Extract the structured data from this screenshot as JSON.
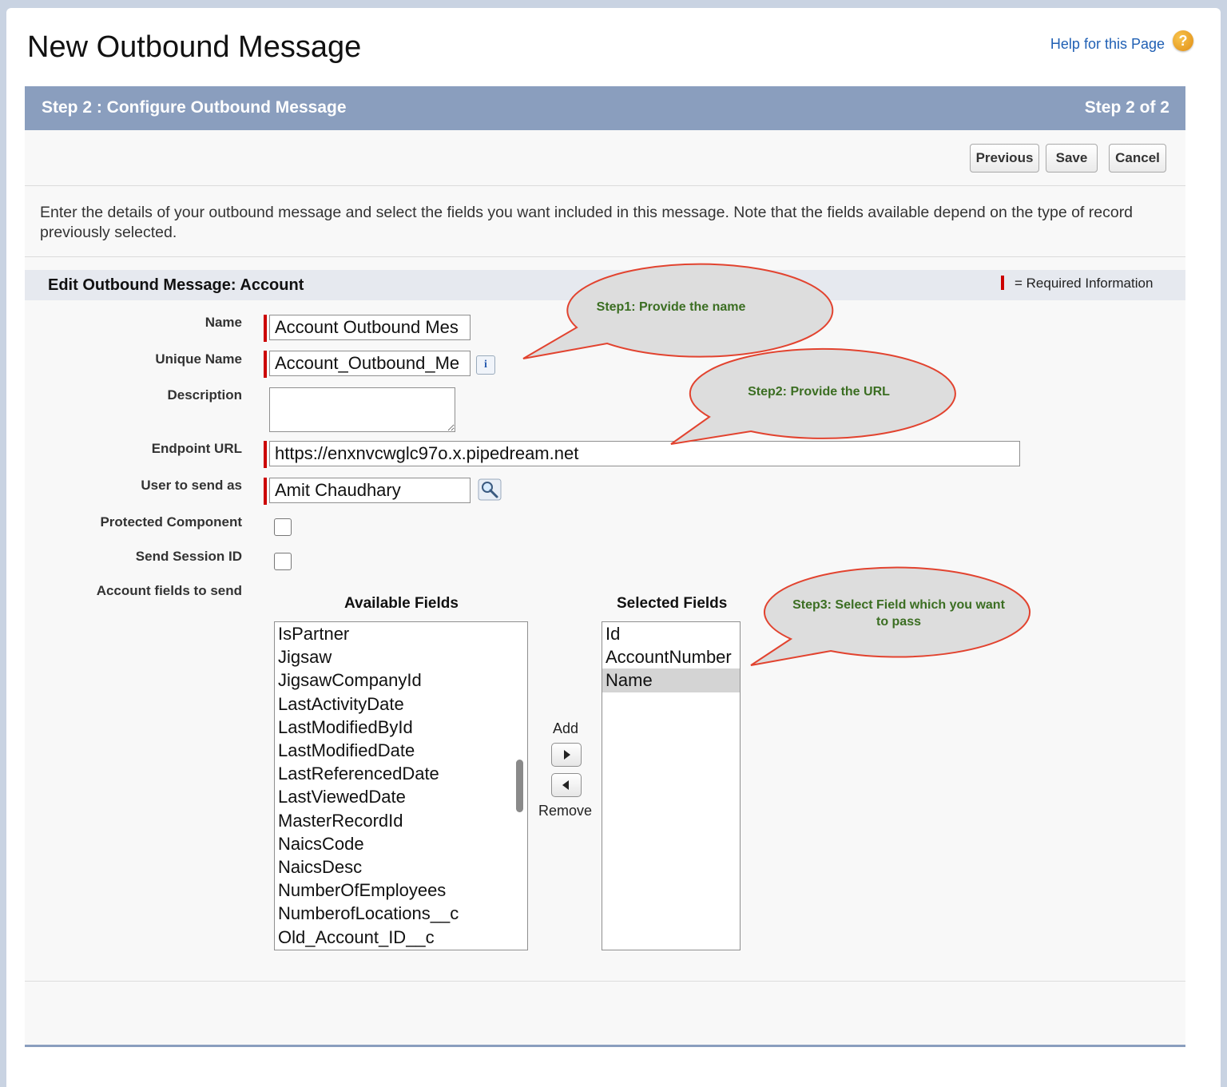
{
  "page": {
    "title": "New Outbound Message",
    "help_link": "Help for this Page",
    "help_icon": "help-question-icon"
  },
  "step": {
    "title": "Step 2 : Configure Outbound Message",
    "count": "Step 2 of 2"
  },
  "toolbar": {
    "previous_label": "Previous",
    "save_label": "Save",
    "cancel_label": "Cancel"
  },
  "intro": "Enter the details of your outbound message and select the fields you want included in this message. Note that the fields available depend on the type of record previously selected.",
  "section": {
    "title": "Edit Outbound Message: Account",
    "required_legend": "= Required Information"
  },
  "form": {
    "name_label": "Name",
    "name_value": "Account Outbound Mes",
    "unique_name_label": "Unique Name",
    "unique_name_value": "Account_Outbound_Me",
    "description_label": "Description",
    "description_value": "",
    "endpoint_label": "Endpoint URL",
    "endpoint_value": "https://enxnvcwglc97o.x.pipedream.net",
    "user_label": "User to send as",
    "user_value": "Amit Chaudhary",
    "protected_label": "Protected Component",
    "session_label": "Send Session ID",
    "fields_label": "Account fields to send"
  },
  "available": {
    "title": "Available Fields",
    "items": [
      "IsPartner",
      "Jigsaw",
      "JigsawCompanyId",
      "LastActivityDate",
      "LastModifiedById",
      "LastModifiedDate",
      "LastReferencedDate",
      "LastViewedDate",
      "MasterRecordId",
      "NaicsCode",
      "NaicsDesc",
      "NumberOfEmployees",
      "NumberofLocations__c",
      "Old_Account_ID__c"
    ]
  },
  "mover": {
    "add_label": "Add",
    "remove_label": "Remove"
  },
  "selected": {
    "title": "Selected Fields",
    "items": [
      "Id",
      "AccountNumber",
      "Name"
    ],
    "highlighted": "Name"
  },
  "callouts": {
    "step1": "Step1: Provide the name",
    "step2": "Step2: Provide the URL",
    "step3_line1": "Step3: Select Field which you want",
    "step3_line2": "to pass"
  },
  "colors": {
    "header_bg": "#8a9ebe",
    "required": "#cc0000",
    "callout_border": "#e2432f",
    "callout_text": "#3b6e22"
  }
}
